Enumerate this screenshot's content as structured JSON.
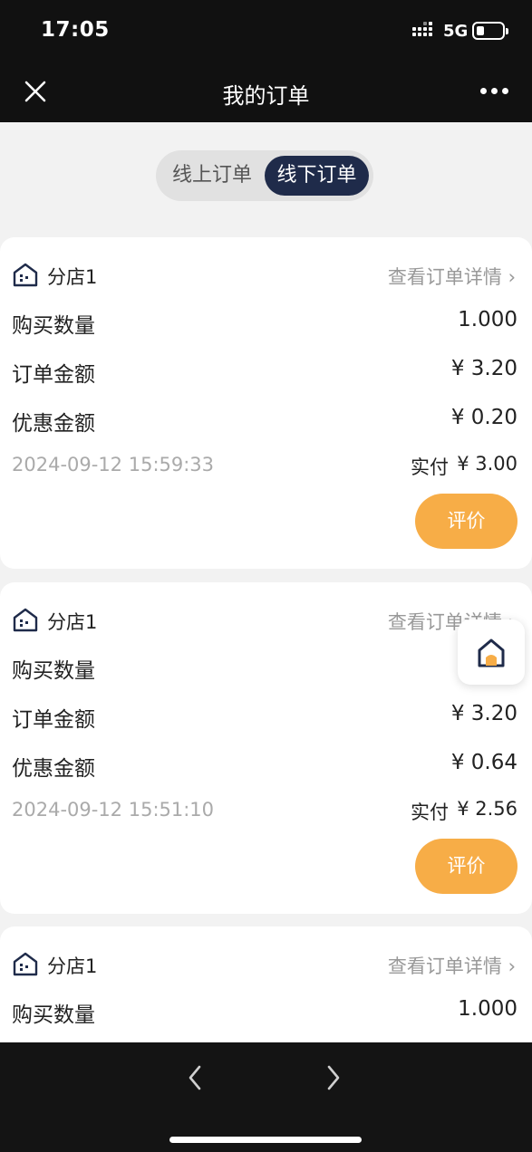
{
  "status_bar": {
    "time": "17:05",
    "network": "5G"
  },
  "nav": {
    "title": "我的订单"
  },
  "tabs": [
    {
      "label": "线上订单",
      "active": false
    },
    {
      "label": "线下订单",
      "active": true
    }
  ],
  "orders": [
    {
      "store": "分店1",
      "detail_link": "查看订单详情 ›",
      "qty_label": "购买数量",
      "qty_value": "1.000",
      "amount_label": "订单金额",
      "amount_value": "¥ 3.20",
      "discount_label": "优惠金额",
      "discount_value": "¥ 0.20",
      "time": "2024-09-12 15:59:33",
      "paid_label": "实付",
      "paid_value": "¥ 3.00",
      "review_label": "评价"
    },
    {
      "store": "分店1",
      "detail_link": "查看订单详情 ›",
      "qty_label": "购买数量",
      "qty_value": "",
      "amount_label": "订单金额",
      "amount_value": "¥ 3.20",
      "discount_label": "优惠金额",
      "discount_value": "¥ 0.64",
      "time": "2024-09-12 15:51:10",
      "paid_label": "实付",
      "paid_value": "¥ 2.56",
      "review_label": "评价"
    },
    {
      "store": "分店1",
      "detail_link": "查看订单详情 ›",
      "qty_label": "购买数量",
      "qty_value": "1.000"
    }
  ],
  "colors": {
    "active_tab": "#1f2b4a",
    "review_button": "#f7ad47",
    "store_icon": "#1f2b4a",
    "home_icon_accent": "#f7ad47"
  },
  "icons": {
    "close": "close-icon",
    "more": "more-dots-icon",
    "store": "store-icon",
    "home": "home-icon",
    "back": "chevron-left-icon",
    "forward": "chevron-right-icon"
  }
}
